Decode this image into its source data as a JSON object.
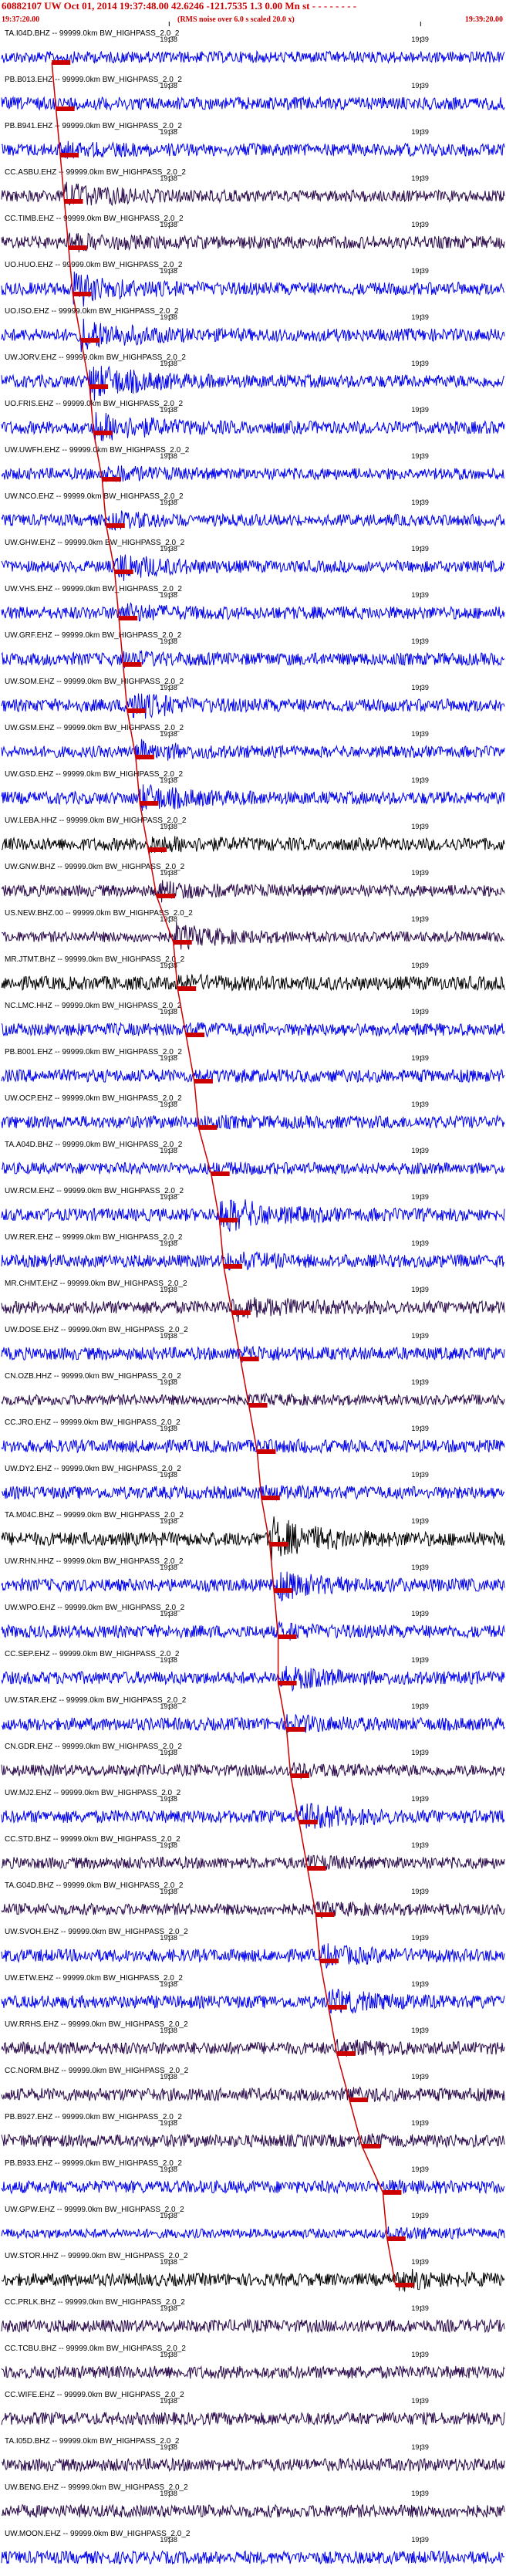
{
  "header": {
    "title": "60882107 UW Oct 01, 2014 19:37:48.00   42.6246 -121.7535  1.3 0.00 Mn st - - - - - - - -",
    "start_time": "19:37:20.00",
    "note": "(RMS noise over 6.0 s scaled 20.0 x)",
    "end_time": "19:39:20.00"
  },
  "colors": {
    "blue": "#0000ee",
    "dark": "#2a0a4a",
    "black": "#000000",
    "pick": "#cc0000"
  },
  "chart_data": {
    "type": "line",
    "title": "60882107 UW Oct 01, 2014 19:37:48.00   42.6246 -121.7535  1.3 0.00 Mn st - - - - - - - -",
    "x_range": [
      "19:37:20.00",
      "19:39:20.00"
    ],
    "tick_labels": [
      "19:38",
      "19:39"
    ],
    "series": [
      {
        "label": "TA.I04D.BHZ -- 99999.0km BW_HIGHPASS_2.0_2",
        "color": "blue",
        "amp": 0.25,
        "burst": 0.0,
        "pick": 12
      },
      {
        "label": "PB.B013.EHZ -- 99999.0km BW_HIGHPASS_2.0_2",
        "color": "blue",
        "amp": 0.3,
        "burst": 0.0,
        "pick": 13
      },
      {
        "label": "PB.B941.EHZ -- 99999.0km BW_HIGHPASS_2.0_2",
        "color": "blue",
        "amp": 0.3,
        "burst": 0.2,
        "pick": 14
      },
      {
        "label": "CC.ASBU.EHZ -- 99999.0km BW_HIGHPASS_2.0_2",
        "color": "dark",
        "amp": 0.25,
        "burst": 0.6,
        "pick": 15
      },
      {
        "label": "CC.TIMB.EHZ -- 99999.0km BW_HIGHPASS_2.0_2",
        "color": "dark",
        "amp": 0.3,
        "burst": 0.3,
        "pick": 16
      },
      {
        "label": "UO.HUO.EHZ -- 99999.0km BW_HIGHPASS_2.0_2",
        "color": "blue",
        "amp": 0.3,
        "burst": 0.8,
        "pick": 17
      },
      {
        "label": "UO.ISO.EHZ -- 99999.0km BW_HIGHPASS_2.0_2",
        "color": "blue",
        "amp": 0.3,
        "burst": 0.8,
        "pick": 19
      },
      {
        "label": "UW.JORV.EHZ -- 99999.0km BW_HIGHPASS_2.0_2",
        "color": "blue",
        "amp": 0.3,
        "burst": 0.9,
        "pick": 21
      },
      {
        "label": "UO.FRIS.EHZ -- 99999.0km BW_HIGHPASS_2.0_2",
        "color": "blue",
        "amp": 0.3,
        "burst": 0.8,
        "pick": 22
      },
      {
        "label": "UW.UWFH.EHZ -- 99999.0km BW_HIGHPASS_2.0_2",
        "color": "blue",
        "amp": 0.25,
        "burst": 0.3,
        "pick": 24
      },
      {
        "label": "UW.NCO.EHZ -- 99999.0km BW_HIGHPASS_2.0_2",
        "color": "blue",
        "amp": 0.25,
        "burst": 0.3,
        "pick": 25
      },
      {
        "label": "UW.GHW.EHZ -- 99999.0km BW_HIGHPASS_2.0_2",
        "color": "blue",
        "amp": 0.25,
        "burst": 0.7,
        "pick": 27
      },
      {
        "label": "UW.VHS.EHZ -- 99999.0km BW_HIGHPASS_2.0_2",
        "color": "blue",
        "amp": 0.3,
        "burst": 0.3,
        "pick": 28
      },
      {
        "label": "UW.GRF.EHZ -- 99999.0km BW_HIGHPASS_2.0_2",
        "color": "blue",
        "amp": 0.3,
        "burst": 0.2,
        "pick": 29
      },
      {
        "label": "UW.SOM.EHZ -- 99999.0km BW_HIGHPASS_2.0_2",
        "color": "blue",
        "amp": 0.3,
        "burst": 0.6,
        "pick": 30
      },
      {
        "label": "UW.GSM.EHZ -- 99999.0km BW_HIGHPASS_2.0_2",
        "color": "blue",
        "amp": 0.25,
        "burst": 0.4,
        "pick": 32
      },
      {
        "label": "UW.GSD.EHZ -- 99999.0km BW_HIGHPASS_2.0_2",
        "color": "blue",
        "amp": 0.3,
        "burst": 0.6,
        "pick": 33
      },
      {
        "label": "UW.LEBA.HHZ -- 99999.0km BW_HIGHPASS_2.0_2",
        "color": "black",
        "amp": 0.3,
        "burst": 0.3,
        "pick": 35
      },
      {
        "label": "UW.GNW.BHZ -- 99999.0km BW_HIGHPASS_2.0_2",
        "color": "dark",
        "amp": 0.25,
        "burst": 0.4,
        "pick": 37
      },
      {
        "label": "US.NEW.BHZ.00 -- 99999.0km BW_HIGHPASS_2.0_2",
        "color": "dark",
        "amp": 0.2,
        "burst": 0.6,
        "pick": 41
      },
      {
        "label": "MR.JTMT.BHZ -- 99999.0km BW_HIGHPASS_2.0_2",
        "color": "black",
        "amp": 0.35,
        "burst": 0.2,
        "pick": 42
      },
      {
        "label": "NC.LMC.HHZ -- 99999.0km BW_HIGHPASS_2.0_2",
        "color": "blue",
        "amp": 0.3,
        "burst": 0.1,
        "pick": 44
      },
      {
        "label": "PB.B001.EHZ -- 99999.0km BW_HIGHPASS_2.0_2",
        "color": "blue",
        "amp": 0.3,
        "burst": 0.1,
        "pick": 46
      },
      {
        "label": "UW.OCP.EHZ -- 99999.0km BW_HIGHPASS_2.0_2",
        "color": "blue",
        "amp": 0.3,
        "burst": 0.1,
        "pick": 47
      },
      {
        "label": "TA.A04D.BHZ -- 99999.0km BW_HIGHPASS_2.0_2",
        "color": "blue",
        "amp": 0.25,
        "burst": 0.1,
        "pick": 50
      },
      {
        "label": "UW.RCM.EHZ -- 99999.0km BW_HIGHPASS_2.0_2",
        "color": "blue",
        "amp": 0.3,
        "burst": 0.9,
        "pick": 52
      },
      {
        "label": "UW.RER.EHZ -- 99999.0km BW_HIGHPASS_2.0_2",
        "color": "blue",
        "amp": 0.3,
        "burst": 0.3,
        "pick": 53
      },
      {
        "label": "MR.CHMT.EHZ -- 99999.0km BW_HIGHPASS_2.0_2",
        "color": "dark",
        "amp": 0.3,
        "burst": 0.6,
        "pick": 55
      },
      {
        "label": "UW.DOSE.EHZ -- 99999.0km BW_HIGHPASS_2.0_2",
        "color": "blue",
        "amp": 0.3,
        "burst": 0.2,
        "pick": 57
      },
      {
        "label": "CN.OZB.HHZ -- 99999.0km BW_HIGHPASS_2.0_2",
        "color": "dark",
        "amp": 0.2,
        "burst": 0.1,
        "pick": 59
      },
      {
        "label": "CC.JRO.EHZ -- 99999.0km BW_HIGHPASS_2.0_2",
        "color": "blue",
        "amp": 0.3,
        "burst": 0.1,
        "pick": 61
      },
      {
        "label": "UW.DY2.EHZ -- 99999.0km BW_HIGHPASS_2.0_2",
        "color": "blue",
        "amp": 0.3,
        "burst": 0.1,
        "pick": 62
      },
      {
        "label": "TA.M04C.BHZ -- 99999.0km BW_HIGHPASS_2.0_2",
        "color": "black",
        "amp": 0.35,
        "burst": 1.0,
        "pick": 64
      },
      {
        "label": "UW.RHN.HHZ -- 99999.0km BW_HIGHPASS_2.0_2",
        "color": "blue",
        "amp": 0.3,
        "burst": 0.7,
        "pick": 65
      },
      {
        "label": "UW.WPO.EHZ -- 99999.0km BW_HIGHPASS_2.0_2",
        "color": "blue",
        "amp": 0.3,
        "burst": 0.2,
        "pick": 66
      },
      {
        "label": "CC.SEP.EHZ -- 99999.0km BW_HIGHPASS_2.0_2",
        "color": "blue",
        "amp": 0.3,
        "burst": 0.5,
        "pick": 66
      },
      {
        "label": "UW.STAR.EHZ -- 99999.0km BW_HIGHPASS_2.0_2",
        "color": "blue",
        "amp": 0.3,
        "burst": 0.3,
        "pick": 68
      },
      {
        "label": "CN.GDR.EHZ -- 99999.0km BW_HIGHPASS_2.0_2",
        "color": "dark",
        "amp": 0.25,
        "burst": 0.2,
        "pick": 69
      },
      {
        "label": "UW.MJ2.EHZ -- 99999.0km BW_HIGHPASS_2.0_2",
        "color": "blue",
        "amp": 0.3,
        "burst": 0.6,
        "pick": 71
      },
      {
        "label": "CC.STD.BHZ -- 99999.0km BW_HIGHPASS_2.0_2",
        "color": "dark",
        "amp": 0.25,
        "burst": 0.2,
        "pick": 73
      },
      {
        "label": "TA.G04D.BHZ -- 99999.0km BW_HIGHPASS_2.0_2",
        "color": "dark",
        "amp": 0.25,
        "burst": 0.2,
        "pick": 75
      },
      {
        "label": "UW.SVOH.EHZ -- 99999.0km BW_HIGHPASS_2.0_2",
        "color": "blue",
        "amp": 0.3,
        "burst": 0.4,
        "pick": 76
      },
      {
        "label": "UW.ETW.EHZ -- 99999.0km BW_HIGHPASS_2.0_2",
        "color": "blue",
        "amp": 0.3,
        "burst": 0.5,
        "pick": 78
      },
      {
        "label": "UW.RRHS.EHZ -- 99999.0km BW_HIGHPASS_2.0_2",
        "color": "dark",
        "amp": 0.3,
        "burst": 0.2,
        "pick": 80
      },
      {
        "label": "CC.NORM.BHZ -- 99999.0km BW_HIGHPASS_2.0_2",
        "color": "dark",
        "amp": 0.3,
        "burst": 0.1,
        "pick": 83
      },
      {
        "label": "PB.B927.EHZ -- 99999.0km BW_HIGHPASS_2.0_2",
        "color": "dark",
        "amp": 0.3,
        "burst": 0.1,
        "pick": 86
      },
      {
        "label": "PB.B933.EHZ -- 99999.0km BW_HIGHPASS_2.0_2",
        "color": "blue",
        "amp": 0.3,
        "burst": 0.1,
        "pick": 91
      },
      {
        "label": "UW.GPW.EHZ -- 99999.0km BW_HIGHPASS_2.0_2",
        "color": "blue",
        "amp": 0.15,
        "burst": 0.2,
        "pick": 92
      },
      {
        "label": "UW.STOR.HHZ -- 99999.0km BW_HIGHPASS_2.0_2",
        "color": "black",
        "amp": 0.3,
        "burst": 0.4,
        "pick": 94
      },
      {
        "label": "CC.PRLK.BHZ -- 99999.0km BW_HIGHPASS_2.0_2",
        "color": "dark",
        "amp": 0.3,
        "burst": 0.0,
        "pick": null
      },
      {
        "label": "CC.TCBU.BHZ -- 99999.0km BW_HIGHPASS_2.0_2",
        "color": "dark",
        "amp": 0.3,
        "burst": 0.0,
        "pick": null
      },
      {
        "label": "CC.WIFE.EHZ -- 99999.0km BW_HIGHPASS_2.0_2",
        "color": "dark",
        "amp": 0.3,
        "burst": 0.0,
        "pick": null
      },
      {
        "label": "TA.I05D.BHZ -- 99999.0km BW_HIGHPASS_2.0_2",
        "color": "dark",
        "amp": 0.3,
        "burst": 0.0,
        "pick": null
      },
      {
        "label": "UW.BENG.EHZ -- 99999.0km BW_HIGHPASS_2.0_2",
        "color": "dark",
        "amp": 0.3,
        "burst": 0.0,
        "pick": null
      },
      {
        "label": "UW.MOON.EHZ -- 99999.0km BW_HIGHPASS_2.0_2",
        "color": "blue",
        "amp": 0.3,
        "burst": 0.1,
        "pick": null
      }
    ]
  }
}
